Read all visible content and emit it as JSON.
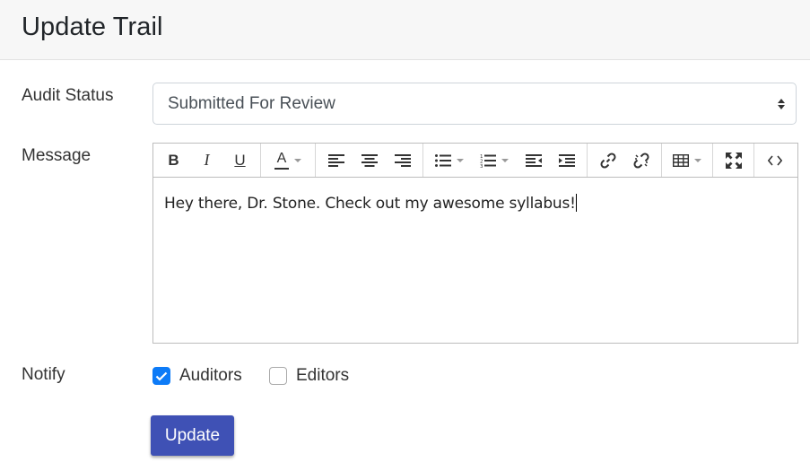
{
  "page": {
    "title": "Update Trail"
  },
  "form": {
    "audit_status": {
      "label": "Audit Status",
      "selected": "Submitted For Review"
    },
    "message": {
      "label": "Message",
      "content": "Hey there, Dr. Stone. Check out my awesome syllabus!",
      "toolbar": {
        "bold": "B",
        "italic": "I",
        "underline": "U",
        "font_color": "A",
        "icons": [
          "bold-icon",
          "italic-icon",
          "underline-icon",
          "font-color-icon",
          "align-left-icon",
          "align-center-icon",
          "align-right-icon",
          "bullet-list-icon",
          "numbered-list-icon",
          "outdent-icon",
          "indent-icon",
          "link-icon",
          "unlink-icon",
          "table-icon",
          "fullscreen-icon",
          "code-view-icon"
        ]
      }
    },
    "notify": {
      "label": "Notify",
      "options": [
        {
          "label": "Auditors",
          "checked": true
        },
        {
          "label": "Editors",
          "checked": false
        }
      ]
    },
    "submit_label": "Update"
  },
  "colors": {
    "primary": "#3f51b5",
    "checkbox": "#0d7bf7"
  }
}
